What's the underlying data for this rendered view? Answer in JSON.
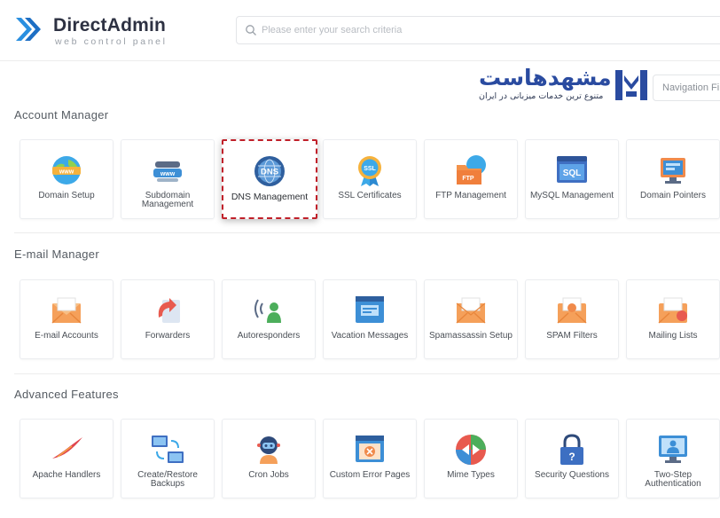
{
  "header": {
    "logo_title": "DirectAdmin",
    "logo_subtitle": "web control panel",
    "search_placeholder": "Please enter your search criteria"
  },
  "watermark": {
    "title": "مشهدهاست",
    "subtitle": "متنوع ترین خدمات میزبانی در ایران"
  },
  "nav_filter": {
    "placeholder": "Navigation Fi"
  },
  "colors": {
    "accent_blue": "#2f7fd0",
    "highlight_red": "#c0202a",
    "orange": "#f5a05a"
  },
  "sections": {
    "account": {
      "title": "Account Manager",
      "items": [
        {
          "label": "Domain Setup",
          "icon": "globe-www-icon"
        },
        {
          "label": "Subdomain Management",
          "icon": "subdomain-www-icon"
        },
        {
          "label": "DNS Management",
          "icon": "dns-globe-icon",
          "highlighted": true
        },
        {
          "label": "SSL Certificates",
          "icon": "ssl-badge-icon"
        },
        {
          "label": "FTP Management",
          "icon": "ftp-folder-icon"
        },
        {
          "label": "MySQL Management",
          "icon": "sql-database-icon"
        },
        {
          "label": "Domain Pointers",
          "icon": "domain-pointer-icon"
        }
      ]
    },
    "email": {
      "title": "E-mail Manager",
      "items": [
        {
          "label": "E-mail Accounts",
          "icon": "envelope-icon"
        },
        {
          "label": "Forwarders",
          "icon": "forward-arrow-icon"
        },
        {
          "label": "Autoresponders",
          "icon": "autoresponder-person-icon"
        },
        {
          "label": "Vacation Messages",
          "icon": "vacation-message-icon"
        },
        {
          "label": "Spamassassin Setup",
          "icon": "spam-envelope-icon"
        },
        {
          "label": "SPAM Filters",
          "icon": "spam-filter-icon"
        },
        {
          "label": "Mailing Lists",
          "icon": "mailing-list-icon"
        }
      ]
    },
    "advanced": {
      "title": "Advanced Features",
      "items": [
        {
          "label": "Apache Handlers",
          "icon": "apache-feather-icon"
        },
        {
          "label": "Create/Restore Backups",
          "icon": "backup-computers-icon"
        },
        {
          "label": "Cron Jobs",
          "icon": "cron-robot-icon"
        },
        {
          "label": "Custom Error Pages",
          "icon": "error-page-icon"
        },
        {
          "label": "Mime Types",
          "icon": "mime-types-icon"
        },
        {
          "label": "Security Questions",
          "icon": "security-lock-icon"
        },
        {
          "label": "Two-Step Authentication",
          "icon": "two-step-auth-icon"
        }
      ]
    }
  }
}
